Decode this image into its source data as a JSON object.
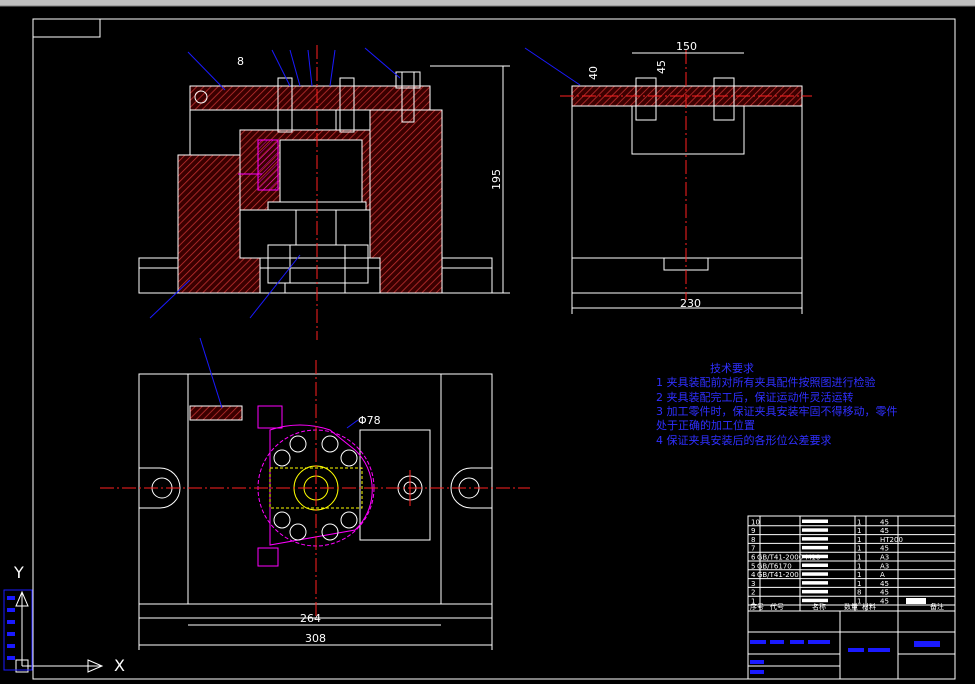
{
  "drawing": {
    "colors": {
      "outline": "#ffffff",
      "section": "#b22222",
      "center": "#ff2020",
      "leader": "#1a1aff",
      "detail": "#ff00ff",
      "highlight": "#ffff00",
      "background": "#000000"
    },
    "dimensions": {
      "height_front": "195",
      "width_side": "230",
      "width_top_inner": "264",
      "width_top_outer": "308",
      "diameter_circle": "Φ78",
      "side_top_width": "150",
      "side_small_a": "40",
      "side_small_b": "45",
      "front_small": "8"
    },
    "tech_notes": {
      "title": "技术要求",
      "lines": [
        "1  夹具装配前对所有夹具配件按照图进行检验",
        "2  夹具装配完工后，保证运动件灵活运转",
        "3  加工零件时，保证夹具安装牢固不得移动，零件",
        "    处于正确的加工位置",
        "4  保证夹具安装后的各形位公差要求"
      ]
    },
    "bom": {
      "rows": [
        {
          "no": "10",
          "qty": "1",
          "mat": "45"
        },
        {
          "no": "9",
          "qty": "1",
          "mat": "45"
        },
        {
          "no": "8",
          "qty": "1",
          "mat": "HT200"
        },
        {
          "no": "7",
          "qty": "1",
          "mat": "45"
        },
        {
          "no": "6",
          "code": "GB/T41-2000 M10",
          "qty": "1",
          "mat": "A3"
        },
        {
          "no": "5",
          "code": "GB/T6170",
          "qty": "1",
          "mat": "A3"
        },
        {
          "no": "4",
          "code": "GB/T41-200",
          "qty": "1",
          "mat": "A"
        },
        {
          "no": "3",
          "qty": "1",
          "mat": "45"
        },
        {
          "no": "2",
          "qty": "8",
          "mat": "45"
        },
        {
          "no": "1",
          "qty": "1",
          "mat": "45"
        }
      ],
      "header": [
        "序号",
        "代号",
        "名称",
        "数量",
        "材料",
        "",
        "备注"
      ]
    },
    "axis": {
      "x_label": "X",
      "y_label": "Y"
    }
  }
}
